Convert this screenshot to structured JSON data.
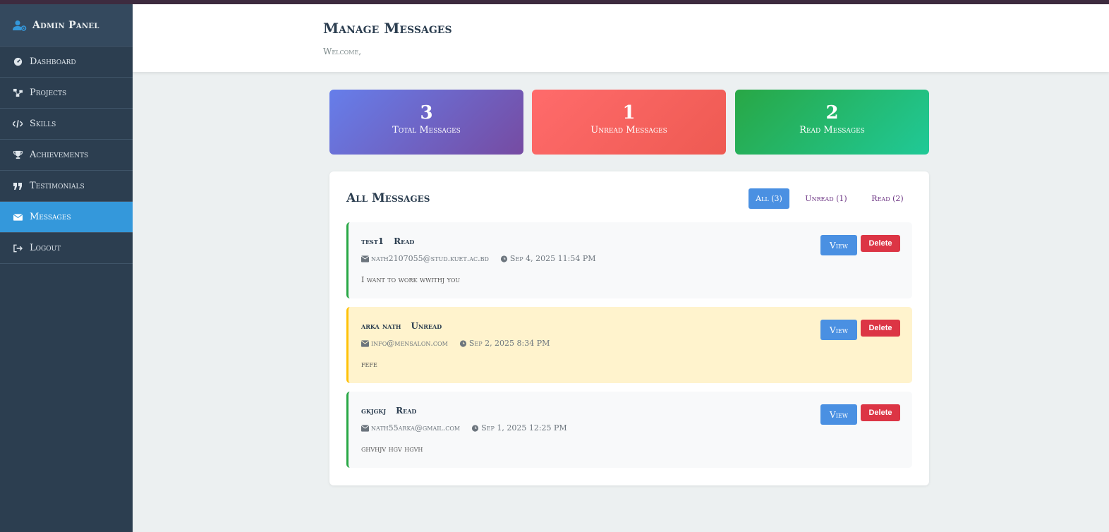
{
  "sidebar": {
    "brand": "Admin Panel",
    "items": [
      {
        "label": "Dashboard",
        "icon": "dashboard-icon"
      },
      {
        "label": "Projects",
        "icon": "projects-icon"
      },
      {
        "label": "Skills",
        "icon": "code-icon"
      },
      {
        "label": "Achievements",
        "icon": "trophy-icon"
      },
      {
        "label": "Testimonials",
        "icon": "quote-icon"
      },
      {
        "label": "Messages",
        "icon": "envelope-icon",
        "active": true
      },
      {
        "label": "Logout",
        "icon": "logout-icon"
      }
    ]
  },
  "header": {
    "title": "Manage Messages",
    "subtitle": "Welcome,"
  },
  "stats": {
    "total": {
      "value": "3",
      "label": "Total Messages"
    },
    "unread": {
      "value": "1",
      "label": "Unread Messages"
    },
    "read": {
      "value": "2",
      "label": "Read Messages"
    }
  },
  "messages_panel": {
    "title": "All Messages",
    "filters": {
      "all": "All (3)",
      "unread": "Unread (1)",
      "read": "Read (2)"
    },
    "messages": [
      {
        "name": "test1",
        "status": "Read",
        "email": "nath2107055@stud.kuet.ac.bd",
        "date": "Sep 4, 2025 11:54 PM",
        "body": "I want to work wwithj you",
        "view_label": "View",
        "delete_label": "Delete"
      },
      {
        "name": "arka nath",
        "status": "Unread",
        "email": "info@mensalon.com",
        "date": "Sep 2, 2025 8:34 PM",
        "body": "fefe",
        "view_label": "View",
        "delete_label": "Delete"
      },
      {
        "name": "gkjgkj",
        "status": "Read",
        "email": "nath55arka@gmail.com",
        "date": "Sep 1, 2025 12:25 PM",
        "body": "ghvhjv hgv hgvh",
        "view_label": "View",
        "delete_label": "Delete"
      }
    ]
  },
  "colors": {
    "sidebar": "#2c3e50",
    "active": "#3498db",
    "unread_bg": "#fff3cd",
    "read_border": "#28a745",
    "unread_border": "#ffc107",
    "delete": "#dc3545"
  }
}
